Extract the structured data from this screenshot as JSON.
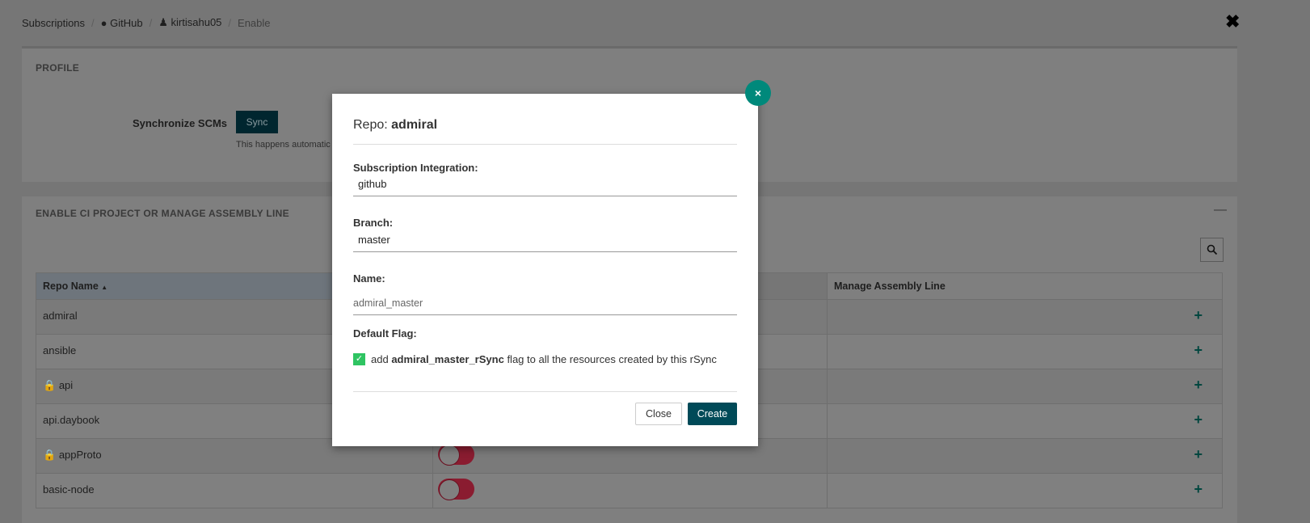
{
  "breadcrumb": {
    "items": [
      "Subscriptions",
      "GitHub",
      "kirtisahu05",
      "Enable"
    ]
  },
  "profile": {
    "title": "PROFILE",
    "sync_label": "Synchronize SCMs",
    "sync_button": "Sync",
    "sync_help": "This happens automatic"
  },
  "assembly": {
    "title": "ENABLE CI PROJECT OR MANAGE ASSEMBLY LINE",
    "columns": [
      "Repo Name",
      "",
      "Manage Assembly Line"
    ],
    "rows": [
      {
        "name": "admiral",
        "locked": false,
        "enabled": false
      },
      {
        "name": "ansible",
        "locked": false,
        "enabled": false
      },
      {
        "name": "api",
        "locked": true,
        "enabled": false
      },
      {
        "name": "api.daybook",
        "locked": false,
        "enabled": false
      },
      {
        "name": "appProto",
        "locked": true,
        "enabled": false
      },
      {
        "name": "basic-node",
        "locked": false,
        "enabled": false
      }
    ]
  },
  "modal": {
    "title_prefix": "Repo:",
    "title_repo": "admiral",
    "integration_label": "Subscription Integration:",
    "integration_value": "github",
    "branch_label": "Branch:",
    "branch_value": "master",
    "name_label": "Name:",
    "name_placeholder": "admiral_master",
    "flag_label": "Default Flag:",
    "flag_checked": true,
    "flag_pre": "add",
    "flag_name": "admiral_master_rSync",
    "flag_post": "flag to all the resources created by this rSync",
    "close_label": "Close",
    "create_label": "Create",
    "close_icon": "×"
  },
  "colors": {
    "accent": "#00897b",
    "primary": "#004a58",
    "toggle_off": "#c8264a",
    "check": "#2fc462"
  }
}
